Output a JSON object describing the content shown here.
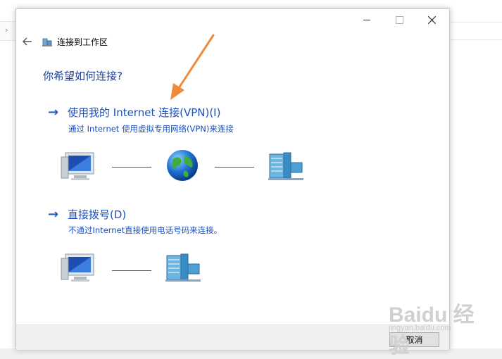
{
  "window": {
    "title": "连接到工作区",
    "controls": {
      "minimize_icon": "minimize-icon",
      "maximize_icon": "maximize-icon",
      "close_icon": "close-icon"
    }
  },
  "page": {
    "heading": "你希望如何连接?"
  },
  "options": [
    {
      "title": "使用我的 Internet 连接(VPN)(I)",
      "description": "通过 Internet 使用虚拟专用网络(VPN)来连接"
    },
    {
      "title": "直接拨号(D)",
      "description": "不通过Internet直接使用电话号码来连接。"
    }
  ],
  "footer": {
    "cancel_label": "取消"
  },
  "watermark": {
    "brand": "Baidu 经验",
    "url": "jingyan.baidu.com"
  },
  "colors": {
    "link": "#1a4fbf",
    "heading": "#1f3f9a",
    "annotation_arrow": "#f08a3a"
  }
}
